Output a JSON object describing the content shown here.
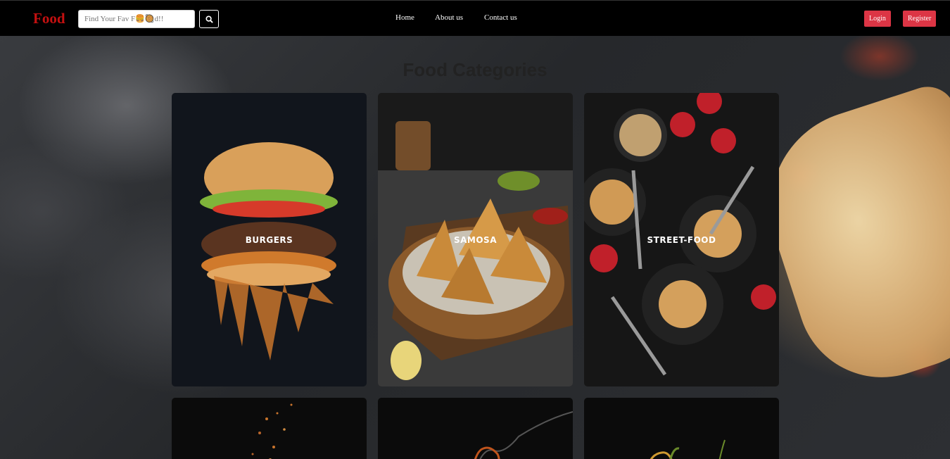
{
  "navbar": {
    "brand": "Food",
    "search_placeholder": "Find Your Fav F🍔🥘d!!",
    "links": [
      "Home",
      "About us",
      "Contact us"
    ],
    "login_label": "Login",
    "register_label": "Register"
  },
  "main": {
    "title": "Food Categories",
    "categories": [
      {
        "label": "BURGERS"
      },
      {
        "label": "SAMOSA"
      },
      {
        "label": "STREET-FOOD"
      },
      {
        "label": ""
      },
      {
        "label": ""
      },
      {
        "label": ""
      }
    ]
  },
  "icons": {
    "search": "search-icon"
  },
  "colors": {
    "brand": "#c41010",
    "button": "#dc3545",
    "navbar": "#000000"
  }
}
